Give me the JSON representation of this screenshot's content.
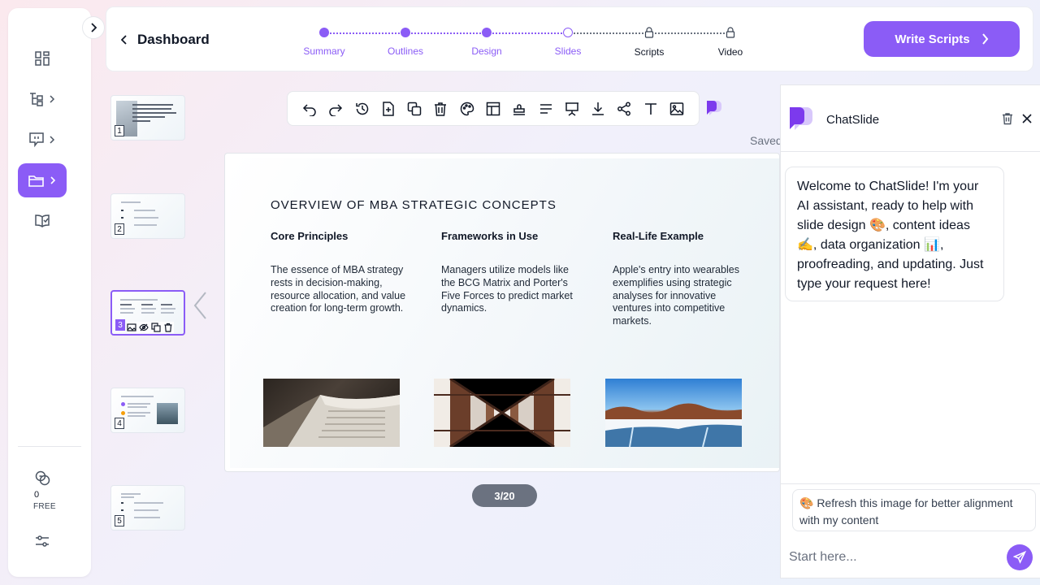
{
  "header": {
    "back_label": "Dashboard",
    "steps": [
      {
        "label": "Summary",
        "state": "done"
      },
      {
        "label": "Outlines",
        "state": "done"
      },
      {
        "label": "Design",
        "state": "done"
      },
      {
        "label": "Slides",
        "state": "current"
      },
      {
        "label": "Scripts",
        "state": "locked"
      },
      {
        "label": "Video",
        "state": "locked"
      }
    ],
    "cta_label": "Write Scripts"
  },
  "sidebar": {
    "items": [
      {
        "icon": "grid-icon"
      },
      {
        "icon": "outline-tree-icon"
      },
      {
        "icon": "presentation-icon"
      },
      {
        "icon": "folder-icon",
        "active": true
      },
      {
        "icon": "book-check-icon"
      }
    ],
    "credits": "0",
    "plan": "FREE"
  },
  "thumbnails": [
    "1",
    "2",
    "3",
    "4",
    "5"
  ],
  "status": {
    "saved": "Saved"
  },
  "pager": "3/20",
  "slide": {
    "title": "OVERVIEW OF MBA STRATEGIC CONCEPTS",
    "columns": [
      {
        "heading": "Core Principles",
        "body": "The essence of MBA strategy rests in decision-making, resource allocation, and value creation for long-term growth."
      },
      {
        "heading": "Frameworks in Use",
        "body": "Managers utilize models like the BCG Matrix and Porter's Five Forces to predict market dynamics."
      },
      {
        "heading": "Real-Life Example",
        "body": "Apple's entry into wearables exemplifies using strategic analyses for innovative ventures into competitive markets."
      }
    ]
  },
  "chat": {
    "title": "ChatSlide",
    "welcome": "Welcome to ChatSlide! I'm your AI assistant, ready to help with slide design 🎨, content ideas ✍️, data organization 📊, proofreading, and updating. Just type your request here!",
    "suggestion": "🎨 Refresh this image for better alignment with my content",
    "placeholder": "Start here..."
  },
  "colors": {
    "accent": "#8b5cf6",
    "pager": "#6b7280"
  }
}
